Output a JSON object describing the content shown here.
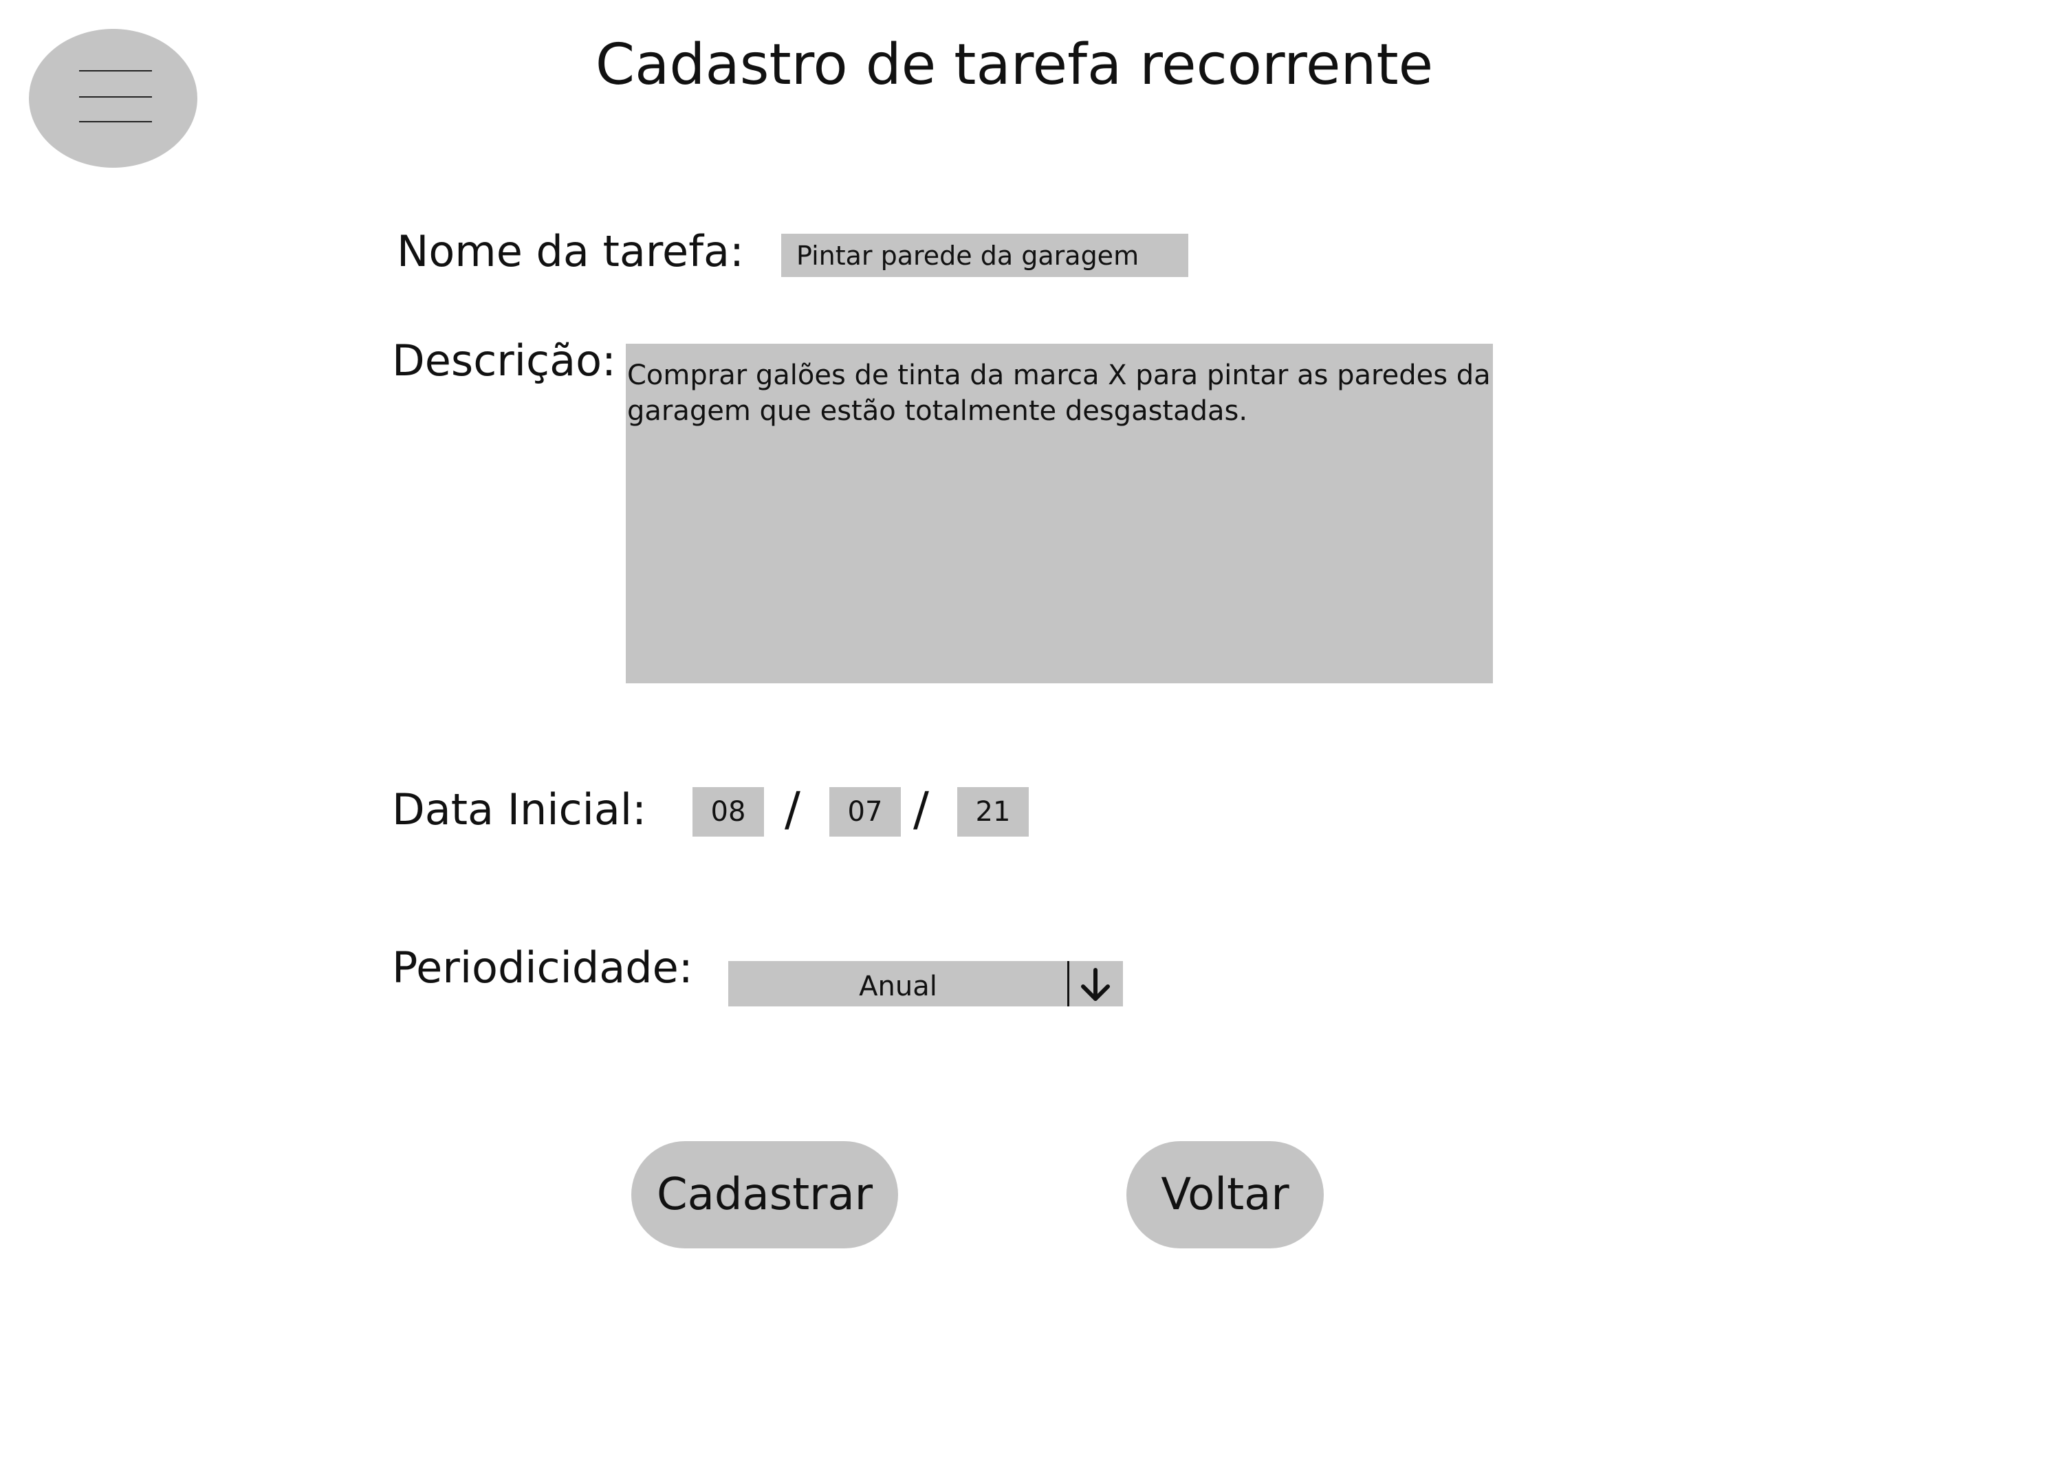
{
  "header": {
    "title": "Cadastro de tarefa recorrente"
  },
  "form": {
    "task_name_label": "Nome da tarefa:",
    "task_name_value": "Pintar parede da garagem",
    "description_label": "Descrição:",
    "description_value": "Comprar galões de tinta da marca X para pintar as paredes da garagem que estão totalmente desgastadas.",
    "start_date_label": "Data Inicial:",
    "start_date": {
      "day": "08",
      "month": "07",
      "year": "21",
      "separator": "/"
    },
    "periodicity_label": "Periodicidade:",
    "periodicity_value": "Anual"
  },
  "actions": {
    "register_label": "Cadastrar",
    "back_label": "Voltar"
  },
  "icons": {
    "menu": "menu-icon",
    "dropdown": "arrow-down-icon"
  },
  "colors": {
    "field_background": "#c4c4c4",
    "text": "#111111",
    "background": "#ffffff"
  }
}
